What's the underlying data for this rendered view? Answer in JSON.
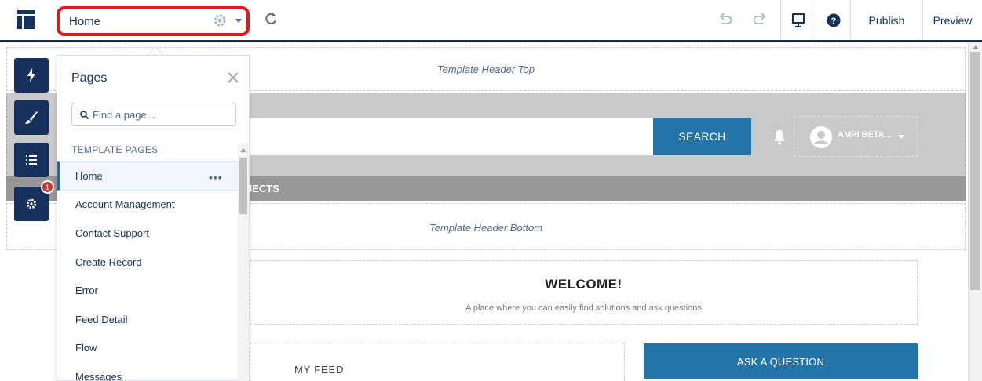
{
  "toolbar": {
    "current_page": "Home",
    "publish_label": "Publish",
    "preview_label": "Preview",
    "icons": [
      "layout-icon",
      "gear-icon",
      "chevron-down-icon",
      "refresh-icon",
      "undo-icon",
      "redo-icon",
      "device-preview-icon",
      "help-icon"
    ]
  },
  "canvas": {
    "header_top_label": "Template Header Top",
    "search_button": "SEARCH",
    "user_name": "AMPI BETA...",
    "nav_label": "JECTS",
    "header_bottom_label": "Template Header Bottom",
    "welcome_title": "WELCOME!",
    "welcome_subtitle": "A place where you can easily find solutions and ask questions",
    "feed_label": "MY FEED",
    "ask_button": "ASK A QUESTION"
  },
  "rail": {
    "badge_count": "1",
    "icons": [
      "lightning-icon",
      "brush-icon",
      "list-icon",
      "gear-icon"
    ]
  },
  "pages_panel": {
    "title": "Pages",
    "search_placeholder": "Find a page...",
    "section_label": "TEMPLATE PAGES",
    "active_dots": "•••",
    "items": [
      {
        "label": "Home",
        "active": true
      },
      {
        "label": "Account Management"
      },
      {
        "label": "Contact Support"
      },
      {
        "label": "Create Record"
      },
      {
        "label": "Error"
      },
      {
        "label": "Feed Detail"
      },
      {
        "label": "Flow"
      },
      {
        "label": "Messages"
      }
    ]
  },
  "colors": {
    "navy": "#16325c",
    "accent_blue": "#2574a9",
    "highlight_red": "#e0191f",
    "gray_band": "#c9c9c9",
    "nav_gray": "#979797"
  }
}
